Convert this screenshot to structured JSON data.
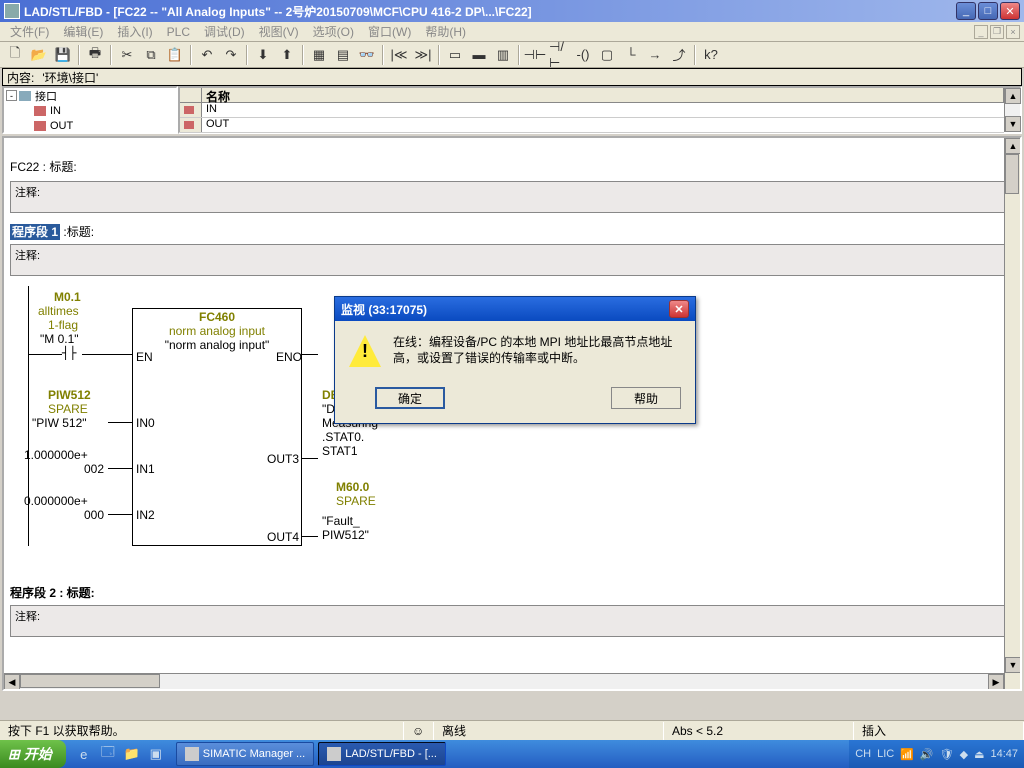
{
  "title": "LAD/STL/FBD  - [FC22 -- \"All Analog Inputs\" -- 2号炉20150709\\MCF\\CPU 416-2 DP\\...\\FC22]",
  "menu": {
    "file": "文件(F)",
    "edit": "编辑(E)",
    "insert": "插入(I)",
    "plc": "PLC",
    "debug": "调试(D)",
    "view": "视图(V)",
    "options": "选项(O)",
    "window": "窗口(W)",
    "help": "帮助(H)"
  },
  "pathbar": {
    "label": "内容:",
    "value": "'环境\\接口'"
  },
  "tree": {
    "root": "接口",
    "in": "IN",
    "out": "OUT"
  },
  "table": {
    "header_name": "名称",
    "row_in": "IN",
    "row_out": "OUT"
  },
  "block_title": "FC22 : 标题:",
  "comment_label": "注释:",
  "seg1_num": "程序段 1",
  "seg1_title": ":标题:",
  "seg2": "程序段 2 : 标题:",
  "fbd": {
    "m01": "M0.1",
    "alltimes": "alltimes",
    "flag": "1-flag",
    "m01q": "\"M 0.1\"",
    "fc460": "FC460",
    "nai": "norm analog input",
    "naiq": "\"norm analog input\"",
    "en": "EN",
    "eno": "ENO",
    "piw512": "PIW512",
    "spare": "SPARE",
    "piw512q": "\"PIW 512\"",
    "in0": "IN0",
    "v1": "1.000000e+",
    "v1b": "002",
    "in1": "IN1",
    "v0": "0.000000e+",
    "v0b": "000",
    "in2": "IN2",
    "out3": "OUT3",
    "out4": "OUT4",
    "db300": "DB300.DBD0",
    "db_hmi": "\"DB_HMI_",
    "meas": "Measuring\"",
    "stat0": ".STAT0.",
    "stat1": "STAT1",
    "m600": "M60.0",
    "spare2": "SPARE",
    "fault": "\"Fault_",
    "piw512b": "PIW512\""
  },
  "dialog": {
    "title": "监视  (33:17075)",
    "text": "在线：编程设备/PC 的本地 MPI 地址比最高节点地址高，或设置了错误的传输率或中断。",
    "ok": "确定",
    "help": "帮助"
  },
  "status": {
    "help": "按下 F1 以获取帮助。",
    "offline": "离线",
    "abs": "Abs < 5.2",
    "insert": "插入"
  },
  "taskbar": {
    "start": "开始",
    "task1": "SIMATIC Manager ...",
    "task2": "LAD/STL/FBD  - [...",
    "lang": "CH",
    "time": "14:47"
  }
}
